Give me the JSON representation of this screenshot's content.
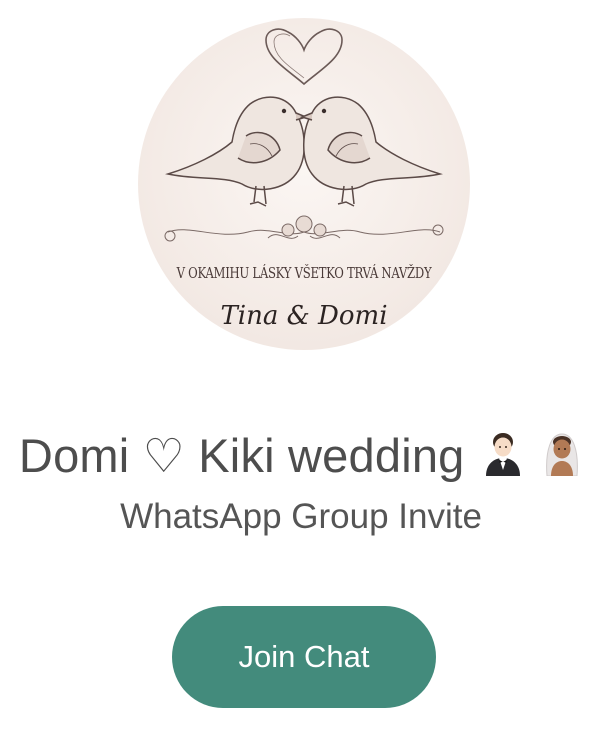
{
  "group": {
    "avatar": {
      "motto": "V OKAMIHU LÁSKY VŠETKO TRVÁ NAVŽDY",
      "signature": "Tina & Domi"
    },
    "title": "Domi ♡ Kiki wedding",
    "title_emoji": [
      "groom-emoji",
      "bride-with-veil-emoji"
    ],
    "subtitle": "WhatsApp Group Invite"
  },
  "actions": {
    "join_label": "Join Chat"
  },
  "colors": {
    "accent": "#438b7c",
    "title_text": "#4d4d4d",
    "subtitle_text": "#555555",
    "avatar_bg": "#f4ebe6"
  }
}
